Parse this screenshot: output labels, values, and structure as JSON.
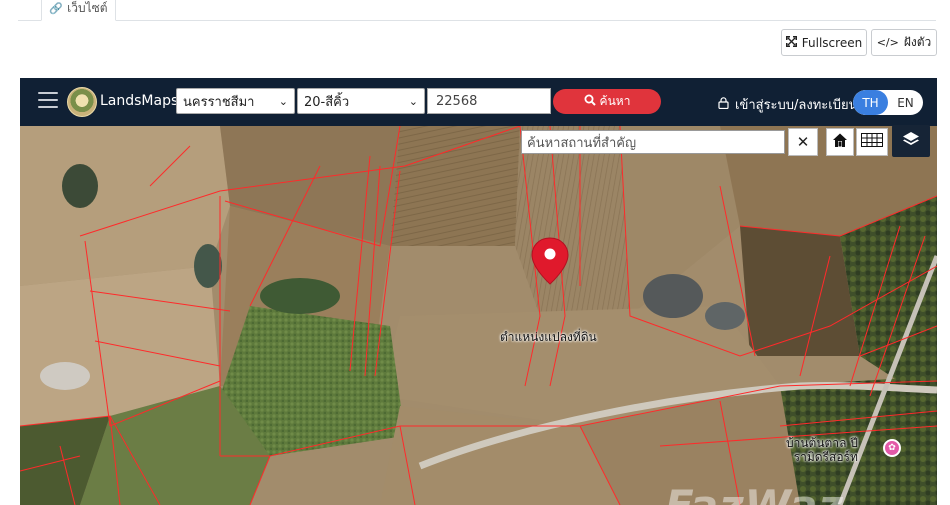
{
  "tabs": {
    "active_label": "เว็บไซต์",
    "link_glyph": "🔗"
  },
  "buttons": {
    "fullscreen": "Fullscreen",
    "embed": "ฝังตัว",
    "embed_icon": "</>"
  },
  "nav": {
    "brand": "LandsMaps",
    "province": "นครราชสีมา",
    "district": "20-สีคิ้ว",
    "parcel_number": "22568",
    "search_label": "ค้นหา",
    "login_label": "เข้าสู่ระบบ/ลงทะเบียน",
    "lang_th": "TH",
    "lang_en": "EN"
  },
  "map": {
    "place_search_placeholder": "ค้นหาสถานที่สำคัญ",
    "clear_symbol": "✕",
    "pin_label": "ตำแหน่งแปลงที่ดิน",
    "poi_line1": "บ้านต้นตาล ปี",
    "poi_line2": "รามิดรีสอร์ท",
    "watermark": "FazWaz",
    "colors": {
      "parcel_lines": "#ff2a2a",
      "pin": "#e0192c"
    }
  }
}
